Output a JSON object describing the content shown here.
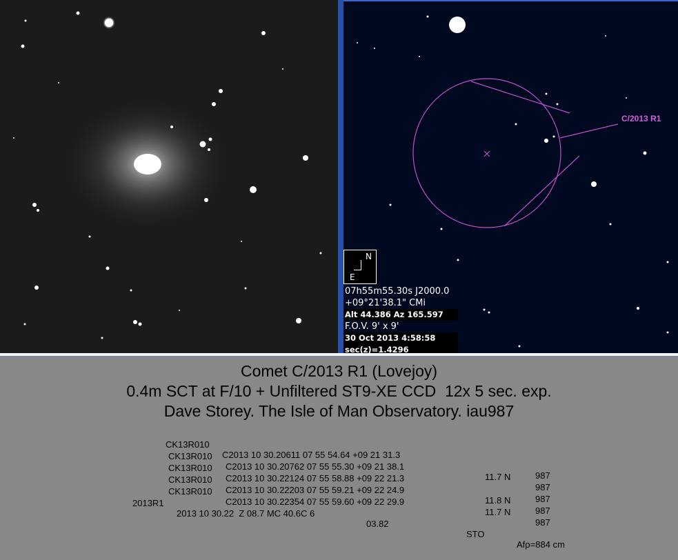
{
  "compass": {
    "north": "N",
    "east": "E"
  },
  "chart_overlay": {
    "comet_label": "C/2013 R1",
    "info_lines": [
      "07h55m55.30s  J2000.0",
      "+09°21'38.1\" CMi",
      "Alt 44.386  Az 165.597",
      "F.O.V. 9' x 9'",
      "30 Oct 2013  4:58:58",
      "sec(z)=1.4296"
    ]
  },
  "caption": {
    "line1": "Comet C/2013 R1 (Lovejoy)",
    "line2": "0.4m SCT at F/10 + Unfiltered ST9-XE CCD  12x 5 sec. exp.",
    "line3": "Dave Storey. The Isle of Man Observatory. iau987"
  },
  "observations": [
    {
      "desig": "CK13R010",
      "record": "C2013 10 30.20611 07 55 54.64 +09 21 31.3",
      "mag": "",
      "obs": "987"
    },
    {
      "desig": "CK13R010",
      "record": "C2013 10 30.20762 07 55 55.30 +09 21 38.1",
      "mag": "11.7 N",
      "obs": "987"
    },
    {
      "desig": "CK13R010",
      "record": "C2013 10 30.22124 07 55 58.88 +09 22 21.3",
      "mag": "",
      "obs": "987"
    },
    {
      "desig": "CK13R010",
      "record": "C2013 10 30.22203 07 55 59.21 +09 22 24.9",
      "mag": "11.8 N",
      "obs": "987"
    },
    {
      "desig": "CK13R010",
      "record": "C2013 10 30.22354 07 55 59.60 +09 22 29.9",
      "mag": "11.7 N",
      "obs": "987"
    }
  ],
  "icq": {
    "id": "2013R1",
    "record": "2013 10 30.22  Z 08.7 MC 40.6C 6",
    "value": "03.82",
    "code": "STO",
    "afp": "Afρ=884 cm"
  }
}
